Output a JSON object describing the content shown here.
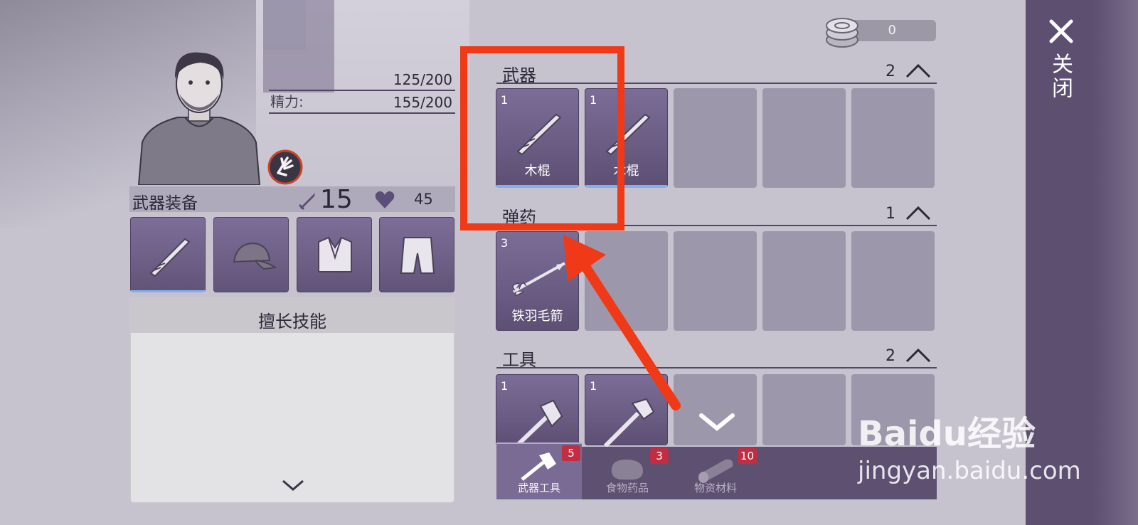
{
  "stats": [
    {
      "label": "",
      "value": "125/200"
    },
    {
      "label": "精力:",
      "value": "155/200"
    }
  ],
  "equipment": {
    "title": "武器装备",
    "attack": "15",
    "health": "45"
  },
  "skills": {
    "title": "擅长技能"
  },
  "coins": "0",
  "sections": [
    {
      "title": "武器",
      "count": "2",
      "items": [
        {
          "qty": "1",
          "name": "木棍"
        },
        {
          "qty": "1",
          "name": "木棍"
        }
      ]
    },
    {
      "title": "弹药",
      "count": "1",
      "items": [
        {
          "qty": "3",
          "name": "铁羽毛箭"
        }
      ]
    },
    {
      "title": "工具",
      "count": "2",
      "items": [
        {
          "qty": "1",
          "name": ""
        },
        {
          "qty": "1",
          "name": ""
        }
      ]
    }
  ],
  "tabs": [
    {
      "label": "武器工具",
      "badge": "5",
      "active": true
    },
    {
      "label": "食物药品",
      "badge": "3",
      "active": false
    },
    {
      "label": "物资材料",
      "badge": "10",
      "active": false
    }
  ],
  "close": {
    "label": "关闭"
  },
  "watermark": {
    "logo": "Baidu经验",
    "url": "jingyan.baidu.com"
  },
  "colors": {
    "highlight": "#f03a17",
    "slot_filled": "#6e6088",
    "slot_empty": "#9d97ab",
    "selected_underline": "#7fb0ef",
    "badge": "#c22d42"
  }
}
